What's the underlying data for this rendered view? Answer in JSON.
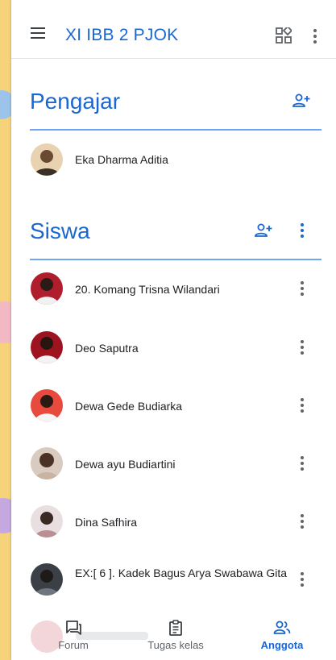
{
  "header": {
    "title": "XI IBB 2 PJOK",
    "menu_icon": "hamburger-icon",
    "apps_icon": "class-apps-icon",
    "more_icon": "more-vert-icon"
  },
  "teachers": {
    "title": "Pengajar",
    "add_icon": "person-add-icon",
    "members": [
      {
        "name": "Eka Dharma Aditia"
      }
    ]
  },
  "students": {
    "title": "Siswa",
    "add_icon": "person-add-icon",
    "members": [
      {
        "name": "20. Komang Trisna Wilandari"
      },
      {
        "name": "Deo Saputra"
      },
      {
        "name": "Dewa Gede Budiarka"
      },
      {
        "name": "Dewa ayu Budiartini"
      },
      {
        "name": "Dina Safhira"
      },
      {
        "name": "EX:[ 6 ]. Kadek Bagus Arya Swabawa Gita"
      }
    ]
  },
  "bottom_nav": {
    "tabs": [
      {
        "label": "Forum",
        "icon": "forum-icon",
        "active": false
      },
      {
        "label": "Tugas kelas",
        "icon": "classwork-icon",
        "active": false
      },
      {
        "label": "Anggota",
        "icon": "people-icon",
        "active": true
      }
    ]
  },
  "colors": {
    "accent": "#1967d2",
    "rule": "#4285f4",
    "text": "#202124",
    "icon": "#5f6368",
    "backdrop": "#f6d27a"
  }
}
